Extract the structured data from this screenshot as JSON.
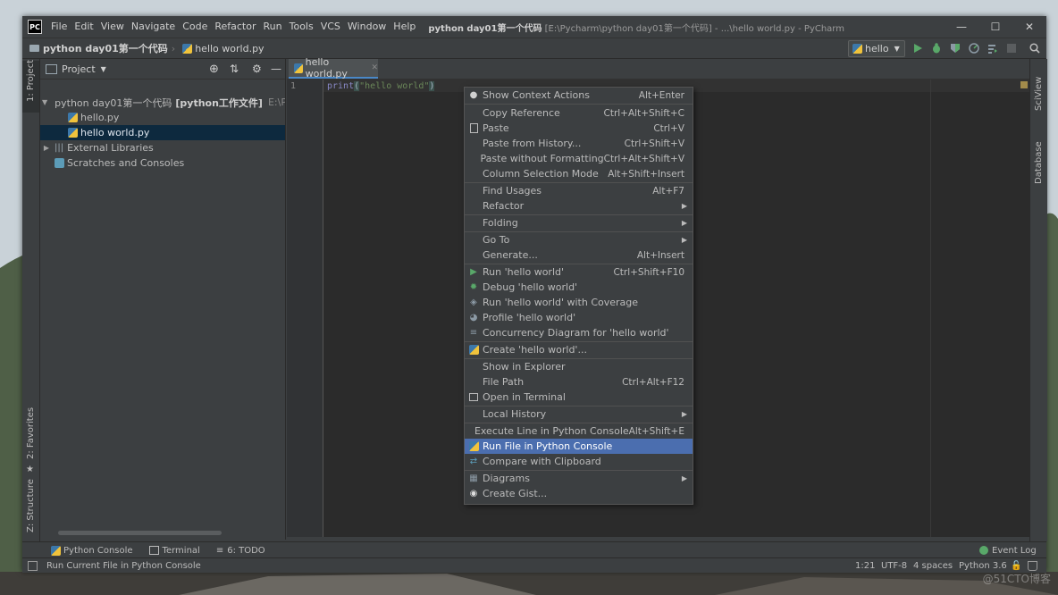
{
  "menu_bar": [
    "File",
    "Edit",
    "View",
    "Navigate",
    "Code",
    "Refactor",
    "Run",
    "Tools",
    "VCS",
    "Window",
    "Help"
  ],
  "window_title_bold": "python  day01第一个代码",
  "window_title_rest": "[E:\\Pycharm\\python  day01第一个代码] - ...\\hello world.py - PyCharm",
  "app_logo": "PC",
  "breadcrumb": {
    "project": "python  day01第一个代码",
    "file": "hello world.py"
  },
  "run_config": "hello",
  "left_stripe": {
    "project": "1: Project",
    "favorites": "2: Favorites",
    "structure": "Z: Structure"
  },
  "right_stripe": {
    "sciview": "SciView",
    "database": "Database"
  },
  "project_panel": {
    "title": "Project",
    "tree": [
      {
        "label": "python  day01第一个代码",
        "bold_suffix": "[python工作文件]",
        "path": "E:\\Pycha",
        "type": "folder",
        "expanded": true
      },
      {
        "label": "hello.py",
        "type": "pyfile"
      },
      {
        "label": "hello world.py",
        "type": "pyfile",
        "selected": true
      },
      {
        "label": "External Libraries",
        "type": "library"
      },
      {
        "label": "Scratches and Consoles",
        "type": "scratch"
      }
    ]
  },
  "editor": {
    "tab_label": "hello world.py",
    "line_number": "1",
    "code_fn": "print",
    "code_open": "(",
    "code_str": "\"hello world\"",
    "code_close": ")"
  },
  "context_menu": [
    {
      "label": "Show Context Actions",
      "shortcut": "Alt+Enter",
      "icon": "bulb-icon"
    },
    {
      "sep": true
    },
    {
      "label": "Copy Reference",
      "shortcut": "Ctrl+Alt+Shift+C"
    },
    {
      "label": "Paste",
      "shortcut": "Ctrl+V",
      "icon": "clipboard-icon"
    },
    {
      "label": "Paste from History...",
      "shortcut": "Ctrl+Shift+V"
    },
    {
      "label": "Paste without Formatting",
      "shortcut": "Ctrl+Alt+Shift+V"
    },
    {
      "label": "Column Selection Mode",
      "shortcut": "Alt+Shift+Insert"
    },
    {
      "sep": true
    },
    {
      "label": "Find Usages",
      "shortcut": "Alt+F7"
    },
    {
      "label": "Refactor",
      "submenu": true
    },
    {
      "sep": true
    },
    {
      "label": "Folding",
      "submenu": true
    },
    {
      "sep": true
    },
    {
      "label": "Go To",
      "submenu": true
    },
    {
      "label": "Generate...",
      "shortcut": "Alt+Insert"
    },
    {
      "sep": true
    },
    {
      "label": "Run 'hello world'",
      "shortcut": "Ctrl+Shift+F10",
      "icon": "run-icon"
    },
    {
      "label": "Debug 'hello world'",
      "icon": "debug-icon"
    },
    {
      "label": "Run 'hello world' with Coverage",
      "icon": "coverage-icon"
    },
    {
      "label": "Profile 'hello world'",
      "icon": "profile-icon"
    },
    {
      "label": "Concurrency Diagram for 'hello world'",
      "icon": "concurrency-icon"
    },
    {
      "sep": true
    },
    {
      "label": "Create 'hello world'...",
      "icon": "python-icon"
    },
    {
      "sep": true
    },
    {
      "label": "Show in Explorer"
    },
    {
      "label": "File Path",
      "shortcut": "Ctrl+Alt+F12"
    },
    {
      "label": "Open in Terminal",
      "icon": "terminal-icon"
    },
    {
      "sep": true
    },
    {
      "label": "Local History",
      "submenu": true
    },
    {
      "sep": true
    },
    {
      "label": "Execute Line in Python Console",
      "shortcut": "Alt+Shift+E"
    },
    {
      "label": "Run File in Python Console",
      "icon": "python-icon",
      "highlighted": true
    },
    {
      "label": "Compare with Clipboard",
      "icon": "compare-icon"
    },
    {
      "sep": true
    },
    {
      "label": "Diagrams",
      "submenu": true,
      "icon": "diagram-icon"
    },
    {
      "label": "Create Gist...",
      "icon": "github-icon"
    }
  ],
  "bottom_tools": [
    {
      "label": "Python Console",
      "icon": "python-icon"
    },
    {
      "label": "Terminal",
      "icon": "terminal-icon"
    },
    {
      "label": "6: TODO",
      "icon": "todo-icon"
    }
  ],
  "event_log": "Event Log",
  "status": {
    "message": "Run Current File in Python Console",
    "position": "1:21",
    "encoding": "UTF-8",
    "indent": "4 spaces",
    "interpreter": "Python 3.6"
  },
  "watermark": "@51CTO博客",
  "colors": {
    "highlight": "#4b6eaf",
    "run_green": "#59a869",
    "string_green": "#6a8759",
    "keyword": "#a9b7c6"
  }
}
